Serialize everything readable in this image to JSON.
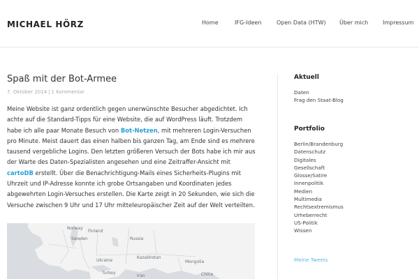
{
  "header": {
    "site_title": "MICHAEL HÖRZ",
    "nav": [
      "Home",
      "IFG-Ideen",
      "Open Data (HTW)",
      "Über mich",
      "Impressum"
    ]
  },
  "post": {
    "title": "Spaß mit der Bot-Armee",
    "date": "7. Oktober 2014",
    "meta_separator": "|",
    "comments": "1 Kommentar",
    "body": {
      "p1": "Meine Website ist ganz ordentlich gegen unerwünschte Besucher abgedichtet. Ich achte auf die Standard-Tipps für eine Website, die auf WordPress läuft. Trotzdem habe ich alle paar Monate Besuch von ",
      "link1": "Bot-Netzen",
      "p2": ", mit mehreren Login-Versuchen pro Minute. Meist dauert das einen halben bis ganzen Tag, am Ende sind es mehrere tausend vergebliche Logins. Den letzten größeren Versuch der Bots habe ich mir aus der Warte des Daten-Spezialisten angesehen und eine Zeitraffer-Ansicht mit ",
      "link2": "cartoDB",
      "p3": " erstellt. Über die Benachrichtigung-Mails eines Sicherheits-Plugins mit Uhrzeit und IP-Adresse konnte ich grobe Ortsangaben und Koordinaten jedes abgewehrten Login-Versuches erstellen. Die Karte zeigt in 20 Sekunden, wie sich die Versuche zwischen 9 Uhr und 17 Uhr mitteleuropäischer Zeit auf der Welt verteilten."
    },
    "map_labels": [
      "Norway",
      "Finland",
      "Sweden",
      "Russia",
      "Kazakhstan",
      "Mongolia",
      "Ukraine",
      "Turkey",
      "Iran",
      "China"
    ]
  },
  "sidebar": {
    "aktuell_title": "Aktuell",
    "aktuell_items": [
      "Daten",
      "Frag den Staat-Blog"
    ],
    "portfolio_title": "Portfolio",
    "portfolio_items": [
      "Berlin/Brandenburg",
      "Datenschutz",
      "Digitales",
      "Gesellschaft",
      "Glosse/Satire",
      "Innenpolitik",
      "Medien",
      "Multimedia",
      "Rechtsextremismus",
      "Urheberrecht",
      "US-Politik",
      "Wissen"
    ],
    "tweets_label": "Meine Tweets"
  },
  "colors": {
    "accent": "#2a9fd6",
    "tweets_link": "#5ab7e6",
    "meta_text": "#aaaaaa",
    "map_water": "#d9dde1",
    "map_land": "#f3f3f3"
  }
}
